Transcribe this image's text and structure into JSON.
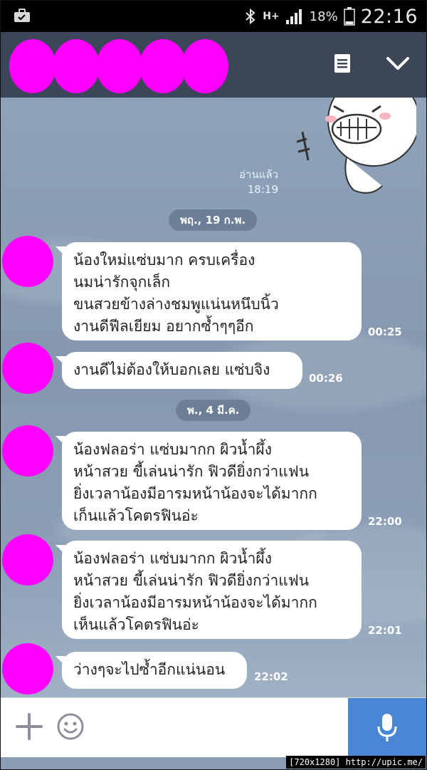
{
  "status_bar": {
    "time": "22:16",
    "battery_percent": "18%",
    "network": "H+",
    "icons": [
      "briefcase-icon",
      "bluetooth-icon",
      "signal-icon",
      "battery-icon"
    ]
  },
  "header": {
    "menu_icon": "notes-icon",
    "collapse_icon": "chevron-down-icon"
  },
  "sent_sticker": {
    "read_label": "อ่านแล้ว",
    "time": "18:19"
  },
  "date_separators": [
    "พฤ., 19 ก.พ.",
    "พ., 4 มี.ค."
  ],
  "messages": [
    {
      "lines": [
        "น้องใหม่แซ่บมาก ครบเครื่อง",
        "นมน่ารักจุกเล็ก",
        "ขนสวยข้างล่างชมพูแน่นหนึบนิ้ว",
        "งานดีฟีลเยียม อยากซ้ำๆๆอีก"
      ],
      "time": "00:25"
    },
    {
      "lines": [
        "งานดีไม่ต้องให้บอกเลย แซ่บจิง"
      ],
      "time": "00:26"
    },
    {
      "lines": [
        "น้องฟลอร่า แซ่บมากก ผิวน้ำผึ้ง",
        "หน้าสวย ขี้เล่นน่ารัก ฟิวดียิ่งกว่าแฟน",
        "ยิ่งเวลาน้องมีอารมหน้าน้องจะได้มากก",
        "เก็นแล้วโคตรฟินอ่ะ"
      ],
      "time": "22:00"
    },
    {
      "lines": [
        "น้องฟลอร่า แซ่บมากก ผิวน้ำผึ้ง",
        "หน้าสวย ขี้เล่นน่ารัก ฟิวดียิ่งกว่าแฟน",
        "ยิ่งเวลาน้องมีอารมหน้าน้องจะได้มากก",
        "เห็นแล้วโคตรฟินอ่ะ"
      ],
      "time": "22:01"
    },
    {
      "lines": [
        "ว่างๆจะไปซ้ำอีกแน่นอน"
      ],
      "time": "22:02"
    }
  ],
  "input_bar": {
    "icons": [
      "plus-icon",
      "emoji-icon",
      "microphone-icon"
    ]
  },
  "watermark": "[720x1280] http://upic.me/",
  "colors": {
    "header_bg": "#3b4659",
    "chat_bg": "#8a9db4",
    "redaction": "#ff00ff",
    "mic_button": "#4a86d6",
    "date_pill": "#6d7f97"
  }
}
